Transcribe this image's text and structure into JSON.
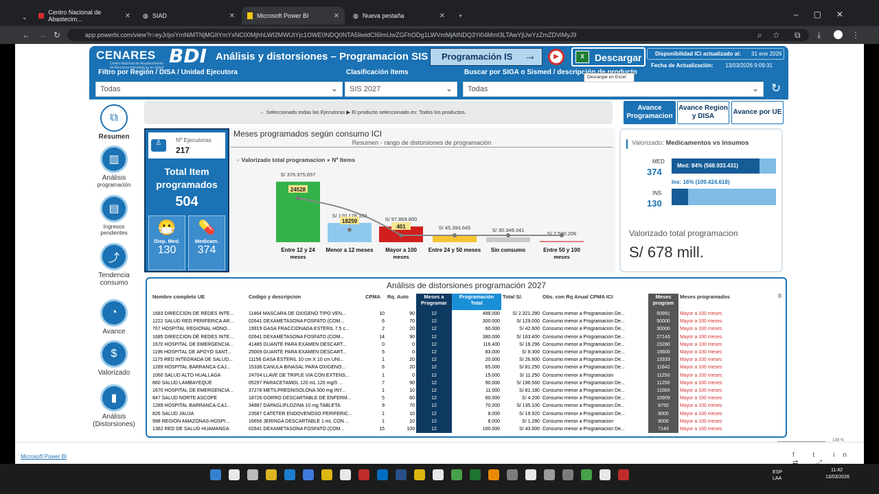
{
  "browser": {
    "tabs": [
      "Centro Nacional de Abastecim...",
      "SIAD",
      "Microsoft Power BI",
      "Nueva pestaña"
    ],
    "url": "app.powerbi.com/view?r=eyJrIjoiYmNiMTNjMGItYmYxNC00MjhhLWI2MWUtYjc1OWE0NDQ0NTA5IiwidCI6ImUwZGFhODg1LWVmMjAtNDQ3Yi04MmI3LTAwYjUwYzZmZDViMyJ9"
  },
  "header": {
    "logo": "CENARES",
    "logo_sub": "Centro Nacional de Abastecimiento de Recursos Estratégicos en Salud",
    "bi": "BDI",
    "title": "Análisis y distorsiones – Programacion SIS",
    "prog_btn": "Programación IS",
    "download_btn": "Descargar",
    "disp_label": "Disponibilidad ICI actualizado al:",
    "disp_date": "31 ene 2026",
    "fecha_label": "Fecha de Actualización:",
    "fecha_value": "13/03/2026 9:09:31",
    "tooltip": "Descargar en Excel"
  },
  "filters": {
    "region_label": "Filtro por Región / DISA / Unidad Ejecutora",
    "region_value": "Todas",
    "clasif_label": "Clasificación ítems",
    "clasif_value": "SIS 2027",
    "buscar_label": "Buscar por SIGA o Sismed / descripción de producto",
    "buscar_value": "Todas"
  },
  "selection_text": "← Seleccionado todas las Ejecutoras  ▶ El producto seleccionado es:  Todos los productos.",
  "tabs": {
    "a": "Avance Programacion",
    "b": "Avance Region y DISA",
    "c": "Avance por UE"
  },
  "sidebar": [
    {
      "label": "Resumen",
      "icon": "presentation-icon"
    },
    {
      "label": "Análisis",
      "sub": "programación",
      "icon": "analysis-chart-icon"
    },
    {
      "label": "Ingresos pendientes",
      "icon": "pallet-icon"
    },
    {
      "label": "Tendencia consumo",
      "icon": "trend-icon"
    },
    {
      "label": "Avance",
      "icon": "progress-gauge-icon"
    },
    {
      "label": "Valorizado",
      "icon": "money-bag-icon"
    },
    {
      "label": "Análisis (Distorsiones)",
      "icon": "bar-chart-icon"
    }
  ],
  "kpi": {
    "ejec_label": "Nº Ejecutoras",
    "ejec_value": "217",
    "total_label": "Total Item programados",
    "total_value": "504",
    "med_label": "Disp. Med.",
    "med_value": "130",
    "medic_label": "Medicam.",
    "medic_value": "374"
  },
  "chart_data": {
    "type": "bar",
    "title": "Meses programados según consumo ICI",
    "subtitle": "Resumen - rango de distorsiones de programación",
    "legend": [
      "Valorizado total programacion",
      "Nº Items"
    ],
    "categories": [
      "Entre 12 y 24 meses",
      "Menor a 12 meses",
      "Mayor a 100 meses",
      "Entre 24 y 50 meses",
      "Sin consumo",
      "Entre 50 y 100 meses"
    ],
    "value_labels": [
      "S/ 376.975.657",
      "S/ 120.178.399",
      "S/ 97.869.800",
      "S/ 45.394.645",
      "S/ 30.349.341",
      "S/ 7.590.206"
    ],
    "values": [
      376975657,
      120178399,
      97869800,
      45394645,
      30349341,
      7590206
    ],
    "items": [
      24528,
      18259,
      401,
      null,
      null,
      null
    ],
    "item_labels": [
      "24528",
      "18259",
      "401",
      "",
      "",
      ""
    ],
    "colors": [
      "#34b24a",
      "#8fc8ee",
      "#d11f1f",
      "#f5c531",
      "#c9c9c9",
      "#e76f6f"
    ]
  },
  "valorizado": {
    "title_a": "Valorizado:",
    "title_b": "Medicamentos vs Insumos",
    "med_label": "MED",
    "med_value": "374",
    "med_bar": "Med: 84% (568.933.431)",
    "med_frac": 0.84,
    "ins_label": "INS",
    "ins_value": "130",
    "ins_bar": "Ins: 16% (109.424.618)",
    "ins_frac": 0.16,
    "total_label": "Valorizado total programacion",
    "total_value": "S/ 678 mill."
  },
  "table": {
    "title": "Análisis de distorsiones programación 2027",
    "headers": [
      "Nombre completo UE",
      "Codigo y descripcion",
      "CPMA",
      "Rq. Auto",
      "Meses a Programar",
      "Programación Total",
      "Total S/.",
      "Obs. con Rq Anual CPMA ICI",
      "Meses program",
      "Meses programados"
    ],
    "rows": [
      [
        "1683 DIRECCION DE REDES INTE...",
        "11464 MASCARA DE OXIGENO TIPO VEN...",
        "10",
        "90",
        "12",
        "498.000",
        "S/ 2.321.280",
        "Consumo menor a Programacion De...",
        "50991",
        "Mayor a 100 meses"
      ],
      [
        "1222 SALUD RED PERIFERICA AR...",
        "02641 DEXAMETASONA FOSFATO (COM...",
        "6",
        "70",
        "12",
        "300.000",
        "S/ 129.000",
        "Consumo menor a Programacion De...",
        "50000",
        "Mayor a 100 meses"
      ],
      [
        "767 HOSPITAL REGIONAL HONO...",
        "19919 GASA FRACCIONADA ESTERIL 7.5 c...",
        "2",
        "20",
        "12",
        "60.000",
        "S/ 42.600",
        "Consumo menor a Programacion De...",
        "30000",
        "Mayor a 100 meses"
      ],
      [
        "1685 DIRECCION DE REDES INTE...",
        "02641 DEXAMETASONA FOSFATO (COM...",
        "14",
        "90",
        "12",
        "380.000",
        "S/ 163.400",
        "Consumo menor a Programacion De...",
        "27143",
        "Mayor a 100 meses"
      ],
      [
        "1670 HOSPITAL DE EMERGENCIA...",
        "41485 GUANTE PARA EXAMEN DESCART...",
        "0",
        "0",
        "12",
        "116.400",
        "S/ 16.296",
        "Consumo menor a Programacion De...",
        "23280",
        "Mayor a 100 meses"
      ],
      [
        "1196 HOSPITAL DE APOYO SANT...",
        "25009 GUANTE PARA EXAMEN DESCART...",
        "5",
        "0",
        "12",
        "83.000",
        "S/ 8.300",
        "Consumo menor a Programacion De...",
        "16600",
        "Mayor a 100 meses"
      ],
      [
        "1175 RED INTEGRADA DE SALUD...",
        "11156 GASA ESTERIL 10 cm X 10 cm  UNI...",
        "1",
        "20",
        "12",
        "20.000",
        "S/ 26.600",
        "Consumo menor a Programacion De...",
        "13333",
        "Mayor a 100 meses"
      ],
      [
        "1289 HOSPITAL BARRANCA-CAJ...",
        "15336 CANULA BINASAL PARA OXIGENO...",
        "6",
        "20",
        "12",
        "65.000",
        "S/ 81.250",
        "Consumo menor a Programacion De...",
        "11642",
        "Mayor a 100 meses"
      ],
      [
        "1060 SALUD ALTO HUALLAGA",
        "24704 LLAVE DE TRIPLE VIA CON EXTENS...",
        "1",
        "0",
        "12",
        "15.000",
        "S/ 11.250",
        "Consumo menor a Programacion",
        "11250",
        "Mayor a 100 meses"
      ],
      [
        "860 SALUD LAMBAYEQUE",
        "05297 PARACETAMOL 120 mL 120 mg/5 ...",
        "7",
        "90",
        "12",
        "90.000",
        "S/ 196.560",
        "Consumo menor a Programacion De...",
        "11250",
        "Mayor a 100 meses"
      ],
      [
        "1670 HOSPITAL DE EMERGENCIA...",
        "37278 METILPREDNISOLONA 500 mg INY...",
        "1",
        "10",
        "12",
        "11.000",
        "S/ 81.180",
        "Consumo menor a Programacion De...",
        "11000",
        "Mayor a 100 meses"
      ],
      [
        "847 SALUD NORTE ASCOPE",
        "18726 GORRO DESCARTABLE DE ENFERM...",
        "5",
        "60",
        "12",
        "60.000",
        "S/ 4.200",
        "Consumo menor a Programacion De...",
        "10909",
        "Mayor a 100 meses"
      ],
      [
        "1289 HOSPITAL BARRANCA-CAJ...",
        "34987 DAPAGLIFLOZINA 10 mg TABLETA",
        "9",
        "70",
        "12",
        "70.000",
        "S/ 135.100",
        "Consumo menor a Programacion De...",
        "8750",
        "Mayor a 100 meses"
      ],
      [
        "826 SALUD JAUJA",
        "23587 CATETER ENDOVENOSO PERIFERIC...",
        "1",
        "10",
        "12",
        "8.000",
        "S/ 19.920",
        "Consumo menor a Programacion De...",
        "8000",
        "Mayor a 100 meses"
      ],
      [
        "998 REGION AMAZONAS-HOSPI...",
        "16656 JERINGA DESCARTABLE 1 mL CON ...",
        "1",
        "10",
        "12",
        "8.000",
        "S/ 1.280",
        "Consumo menor a Programacion",
        "8000",
        "Mayor a 100 meses"
      ],
      [
        "1362 RED DE SALUD HUAMANGA",
        "02641 DEXAMETASONA FOSFATO (COM...",
        "15",
        "100",
        "12",
        "100.000",
        "S/ 43.000",
        "Consumo menor a Programacion De...",
        "7143",
        "Mayor a 100 meses"
      ]
    ]
  },
  "footer": {
    "brand": "Microsoft Power BI",
    "zoom": "138 %"
  },
  "taskbar": {
    "lang": "ESP\nLAA",
    "time": "11:42",
    "date": "13/03/2026"
  }
}
